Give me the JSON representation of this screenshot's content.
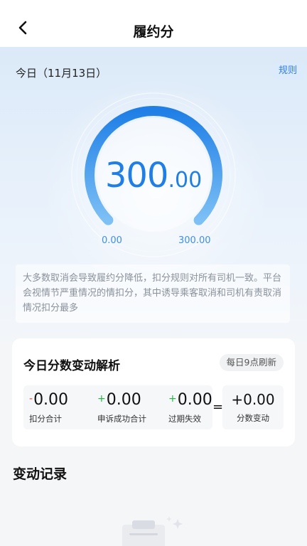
{
  "navbar": {
    "title": "履约分"
  },
  "hero": {
    "today_label": "今日（11月13日）",
    "rules_label": "规则",
    "score": {
      "value": 300.0,
      "max": 300.0,
      "integer_text": "300",
      "decimal_text": ".00"
    },
    "gauge": {
      "min_label": "0.00",
      "max_label": "300.00"
    },
    "notice": "大多数取消会导致履约分降低，扣分规则对所有司机一致。平台会视情节严重情况的情扣分，其中诱导乘客取消和司机有责取消情况扣分最多"
  },
  "analysis": {
    "title": "今日分数变动解析",
    "refresh_label": "每日9点刷新",
    "items": [
      {
        "sign": "-",
        "value": "0.00",
        "label": "扣分合计",
        "sign_color": "#e8453c"
      },
      {
        "sign": "+",
        "value": "0.00",
        "label": "申诉成功合计",
        "sign_color": "#2ab24c"
      },
      {
        "sign": "+",
        "value": "0.00",
        "label": "过期失效",
        "sign_color": "#2ab24c"
      }
    ],
    "equals": "=",
    "total": {
      "value": "+0.00",
      "label": "分数变动"
    }
  },
  "records": {
    "title": "变动记录"
  },
  "colors": {
    "accent": "#1f7fe6",
    "minus": "#e8453c",
    "plus": "#2ab24c"
  }
}
